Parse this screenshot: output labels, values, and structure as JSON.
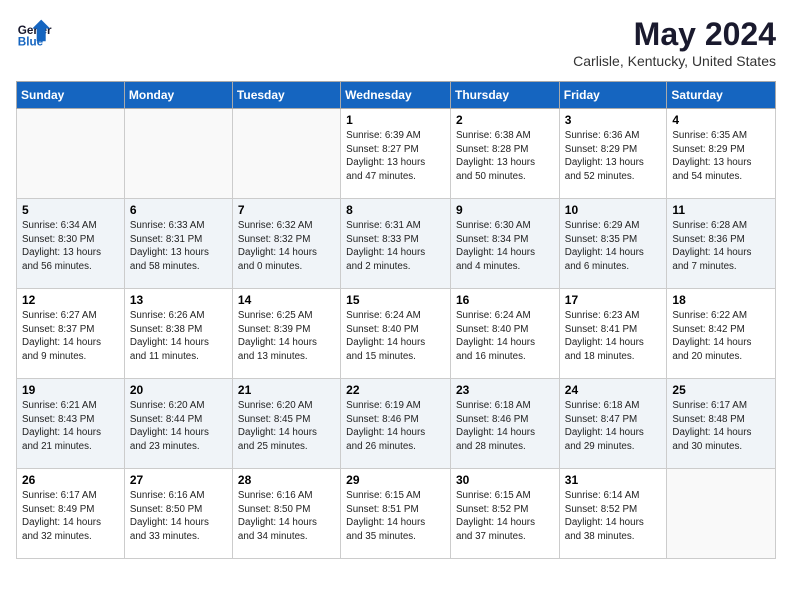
{
  "header": {
    "logo_line1": "General",
    "logo_line2": "Blue",
    "month": "May 2024",
    "location": "Carlisle, Kentucky, United States"
  },
  "weekdays": [
    "Sunday",
    "Monday",
    "Tuesday",
    "Wednesday",
    "Thursday",
    "Friday",
    "Saturday"
  ],
  "weeks": [
    [
      {
        "day": "",
        "info": ""
      },
      {
        "day": "",
        "info": ""
      },
      {
        "day": "",
        "info": ""
      },
      {
        "day": "1",
        "info": "Sunrise: 6:39 AM\nSunset: 8:27 PM\nDaylight: 13 hours\nand 47 minutes."
      },
      {
        "day": "2",
        "info": "Sunrise: 6:38 AM\nSunset: 8:28 PM\nDaylight: 13 hours\nand 50 minutes."
      },
      {
        "day": "3",
        "info": "Sunrise: 6:36 AM\nSunset: 8:29 PM\nDaylight: 13 hours\nand 52 minutes."
      },
      {
        "day": "4",
        "info": "Sunrise: 6:35 AM\nSunset: 8:29 PM\nDaylight: 13 hours\nand 54 minutes."
      }
    ],
    [
      {
        "day": "5",
        "info": "Sunrise: 6:34 AM\nSunset: 8:30 PM\nDaylight: 13 hours\nand 56 minutes."
      },
      {
        "day": "6",
        "info": "Sunrise: 6:33 AM\nSunset: 8:31 PM\nDaylight: 13 hours\nand 58 minutes."
      },
      {
        "day": "7",
        "info": "Sunrise: 6:32 AM\nSunset: 8:32 PM\nDaylight: 14 hours\nand 0 minutes."
      },
      {
        "day": "8",
        "info": "Sunrise: 6:31 AM\nSunset: 8:33 PM\nDaylight: 14 hours\nand 2 minutes."
      },
      {
        "day": "9",
        "info": "Sunrise: 6:30 AM\nSunset: 8:34 PM\nDaylight: 14 hours\nand 4 minutes."
      },
      {
        "day": "10",
        "info": "Sunrise: 6:29 AM\nSunset: 8:35 PM\nDaylight: 14 hours\nand 6 minutes."
      },
      {
        "day": "11",
        "info": "Sunrise: 6:28 AM\nSunset: 8:36 PM\nDaylight: 14 hours\nand 7 minutes."
      }
    ],
    [
      {
        "day": "12",
        "info": "Sunrise: 6:27 AM\nSunset: 8:37 PM\nDaylight: 14 hours\nand 9 minutes."
      },
      {
        "day": "13",
        "info": "Sunrise: 6:26 AM\nSunset: 8:38 PM\nDaylight: 14 hours\nand 11 minutes."
      },
      {
        "day": "14",
        "info": "Sunrise: 6:25 AM\nSunset: 8:39 PM\nDaylight: 14 hours\nand 13 minutes."
      },
      {
        "day": "15",
        "info": "Sunrise: 6:24 AM\nSunset: 8:40 PM\nDaylight: 14 hours\nand 15 minutes."
      },
      {
        "day": "16",
        "info": "Sunrise: 6:24 AM\nSunset: 8:40 PM\nDaylight: 14 hours\nand 16 minutes."
      },
      {
        "day": "17",
        "info": "Sunrise: 6:23 AM\nSunset: 8:41 PM\nDaylight: 14 hours\nand 18 minutes."
      },
      {
        "day": "18",
        "info": "Sunrise: 6:22 AM\nSunset: 8:42 PM\nDaylight: 14 hours\nand 20 minutes."
      }
    ],
    [
      {
        "day": "19",
        "info": "Sunrise: 6:21 AM\nSunset: 8:43 PM\nDaylight: 14 hours\nand 21 minutes."
      },
      {
        "day": "20",
        "info": "Sunrise: 6:20 AM\nSunset: 8:44 PM\nDaylight: 14 hours\nand 23 minutes."
      },
      {
        "day": "21",
        "info": "Sunrise: 6:20 AM\nSunset: 8:45 PM\nDaylight: 14 hours\nand 25 minutes."
      },
      {
        "day": "22",
        "info": "Sunrise: 6:19 AM\nSunset: 8:46 PM\nDaylight: 14 hours\nand 26 minutes."
      },
      {
        "day": "23",
        "info": "Sunrise: 6:18 AM\nSunset: 8:46 PM\nDaylight: 14 hours\nand 28 minutes."
      },
      {
        "day": "24",
        "info": "Sunrise: 6:18 AM\nSunset: 8:47 PM\nDaylight: 14 hours\nand 29 minutes."
      },
      {
        "day": "25",
        "info": "Sunrise: 6:17 AM\nSunset: 8:48 PM\nDaylight: 14 hours\nand 30 minutes."
      }
    ],
    [
      {
        "day": "26",
        "info": "Sunrise: 6:17 AM\nSunset: 8:49 PM\nDaylight: 14 hours\nand 32 minutes."
      },
      {
        "day": "27",
        "info": "Sunrise: 6:16 AM\nSunset: 8:50 PM\nDaylight: 14 hours\nand 33 minutes."
      },
      {
        "day": "28",
        "info": "Sunrise: 6:16 AM\nSunset: 8:50 PM\nDaylight: 14 hours\nand 34 minutes."
      },
      {
        "day": "29",
        "info": "Sunrise: 6:15 AM\nSunset: 8:51 PM\nDaylight: 14 hours\nand 35 minutes."
      },
      {
        "day": "30",
        "info": "Sunrise: 6:15 AM\nSunset: 8:52 PM\nDaylight: 14 hours\nand 37 minutes."
      },
      {
        "day": "31",
        "info": "Sunrise: 6:14 AM\nSunset: 8:52 PM\nDaylight: 14 hours\nand 38 minutes."
      },
      {
        "day": "",
        "info": ""
      }
    ]
  ]
}
